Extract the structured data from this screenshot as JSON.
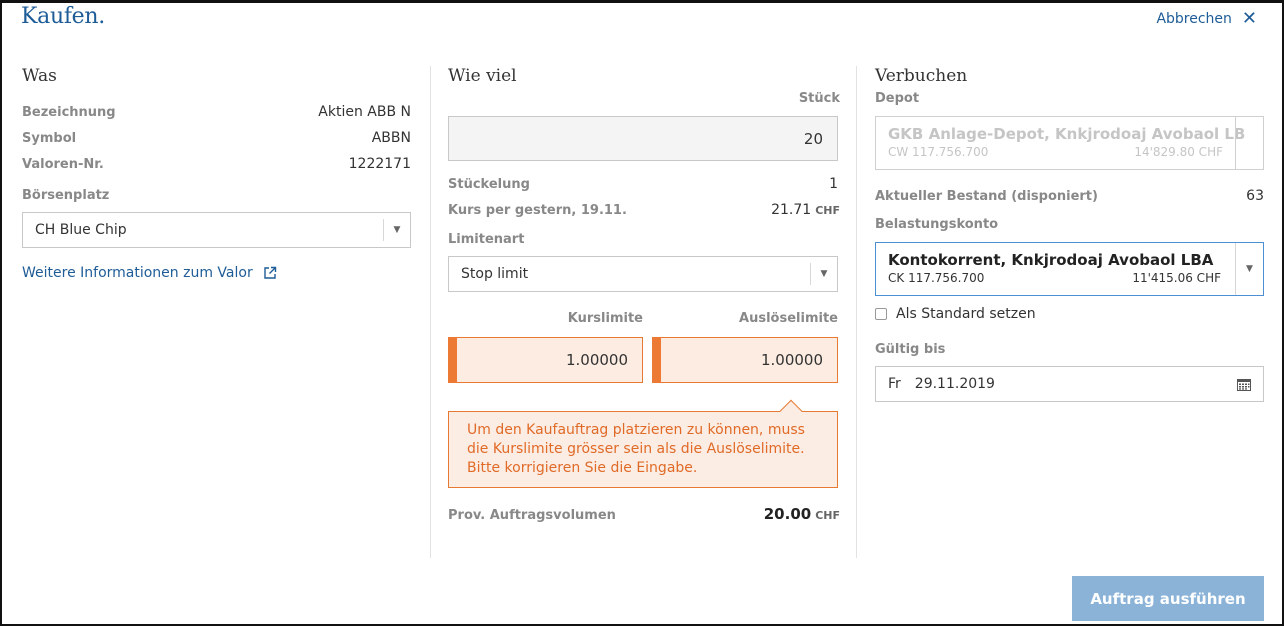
{
  "header": {
    "title": "Kaufen.",
    "cancel_label": "Abbrechen"
  },
  "was": {
    "heading": "Was",
    "rows": [
      {
        "label": "Bezeichnung",
        "value": "Aktien ABB N"
      },
      {
        "label": "Symbol",
        "value": "ABBN"
      },
      {
        "label": "Valoren-Nr.",
        "value": "1222171"
      }
    ],
    "exchange_label": "Börsenplatz",
    "exchange_value": "CH Blue Chip",
    "more_info_link": "Weitere Informationen zum Valor"
  },
  "wie_viel": {
    "heading": "Wie viel",
    "quantity_label": "Stück",
    "quantity_value": "20",
    "denomination_label": "Stückelung",
    "denomination_value": "1",
    "price_label": "Kurs per gestern, 19.11.",
    "price_value": "21.71",
    "price_currency": "CHF",
    "limit_type_label": "Limitenart",
    "limit_type_value": "Stop limit",
    "limit_label": "Kurslimite",
    "limit_value": "1.00000",
    "trigger_label": "Auslöselimite",
    "trigger_value": "1.00000",
    "error_message": "Um den Kaufauftrag platzieren zu können, muss die Kurslimite grösser sein als die Auslöselimite. Bitte korrigieren Sie die Eingabe.",
    "volume_label": "Prov. Auftragsvolumen",
    "volume_value": "20.00",
    "volume_currency": "CHF"
  },
  "verbuchen": {
    "heading": "Verbuchen",
    "depot_label": "Depot",
    "depot_name": "GKB Anlage-Depot, Knkjrodoaj Avobaol LB",
    "depot_number": "CW 117.756.700",
    "depot_balance": "14'829.80 CHF",
    "holdings_label": "Aktueller Bestand (disponiert)",
    "holdings_value": "63",
    "account_label": "Belastungskonto",
    "account_name": "Kontokorrent, Knkjrodoaj Avobaol LBA",
    "account_number": "CK 117.756.700",
    "account_balance": "11'415.06 CHF",
    "default_checkbox_label": "Als Standard setzen",
    "valid_until_label": "Gültig bis",
    "valid_until_day": "Fr",
    "valid_until_date": "29.11.2019"
  },
  "footer": {
    "submit_label": "Auftrag ausführen"
  },
  "colors": {
    "brand": "#1e5c97",
    "error_accent": "#ec7a34",
    "error_background": "#fcede4",
    "submit_background": "#8bb3d8"
  }
}
